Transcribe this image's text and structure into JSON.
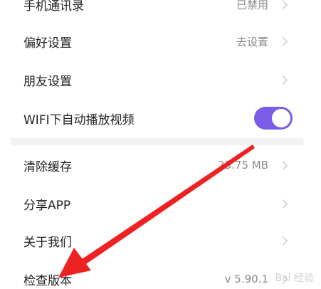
{
  "settings_group_1": {
    "rows": [
      {
        "label": "手机通讯录",
        "value": "已禁用"
      },
      {
        "label": "偏好设置",
        "value": "去设置"
      },
      {
        "label": "朋友设置",
        "value": ""
      },
      {
        "label": "WIFI下自动播放视频",
        "value": "",
        "toggle_on": true
      }
    ]
  },
  "settings_group_2": {
    "rows": [
      {
        "label": "清除缓存",
        "value": "23.75 MB"
      },
      {
        "label": "分享APP",
        "value": ""
      },
      {
        "label": "关于我们",
        "value": ""
      },
      {
        "label": "检查版本",
        "value": "v 5.90.1"
      }
    ]
  },
  "colors": {
    "toggle_on": "#7b5ce6",
    "annotation_arrow": "#ee2222"
  },
  "watermark": {
    "text": "Bai 经验"
  }
}
